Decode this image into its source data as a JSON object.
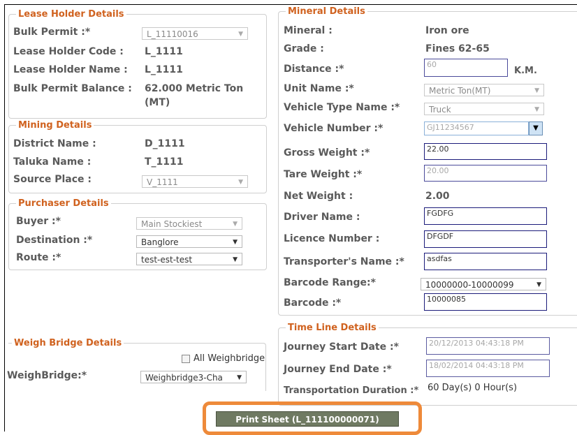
{
  "lease_holder": {
    "legend": "Lease Holder Details",
    "bulk_permit_label": "Bulk Permit :*",
    "bulk_permit_value": "L_11110016",
    "code_label": "Lease Holder Code :",
    "code_value": "L_1111",
    "name_label": "Lease Holder Name :",
    "name_value": "L_1111",
    "balance_label": "Bulk Permit Balance :",
    "balance_value_line1": "62.000  Metric Ton",
    "balance_value_line2": "(MT)"
  },
  "mining": {
    "legend": "Mining Details",
    "district_label": "District Name :",
    "district_value": "D_1111",
    "taluka_label": "Taluka Name :",
    "taluka_value": "T_1111",
    "source_label": "Source Place :",
    "source_value": "V_1111"
  },
  "purchaser": {
    "legend": "Purchaser Details",
    "buyer_label": "Buyer :*",
    "buyer_value": "Main Stockiest",
    "destination_label": "Destination :*",
    "destination_value": "Banglore",
    "route_label": "Route :*",
    "route_value": "test-est-test"
  },
  "weigh_bridge": {
    "legend": "Weigh Bridge Details",
    "all_label": "All Weighbridge",
    "label": "WeighBridge:*",
    "value": "Weighbridge3-Cha"
  },
  "mineral": {
    "legend": "Mineral Details",
    "mineral_label": "Mineral :",
    "mineral_value": "Iron ore",
    "grade_label": "Grade :",
    "grade_value": "Fines 62-65",
    "distance_label": "Distance :*",
    "distance_value": "60",
    "distance_unit": "K.M.",
    "unit_label": "Unit Name :*",
    "unit_value": "Metric Ton(MT)",
    "vehicle_type_label": "Vehicle Type Name :*",
    "vehicle_type_value": "Truck",
    "vehicle_number_label": "Vehicle Number :*",
    "vehicle_number_value": "GJ11234567",
    "gross_label": "Gross Weight :*",
    "gross_value": "22.00",
    "tare_label": "Tare Weight :*",
    "tare_value": "20.00",
    "net_label": "Net Weight :",
    "net_value": "2.00",
    "driver_label": "Driver Name :",
    "driver_value": "FGDFG",
    "licence_label": "Licence Number :",
    "licence_value": "DFGDF",
    "transporter_label": "Transporter's Name :*",
    "transporter_value": "asdfas",
    "barcode_range_label": "Barcode Range:*",
    "barcode_range_value": "10000000-10000099",
    "barcode_label": "Barcode :*",
    "barcode_value": "10000085"
  },
  "timeline": {
    "legend": "Time Line Details",
    "start_label": "Journey Start Date :*",
    "start_value": "20/12/2013 04:43:18 PM",
    "end_label": "Journey End Date :*",
    "end_value": "18/02/2014 04:43:18 PM",
    "duration_label": "Transportation Duration :*",
    "duration_value": "60 Day(s) 0 Hour(s)"
  },
  "actions": {
    "print_label": "Print Sheet (L_111100000071)"
  },
  "colors": {
    "legend": "#d0621f",
    "highlight": "#ee8a3a",
    "button": "#6f7a62"
  }
}
